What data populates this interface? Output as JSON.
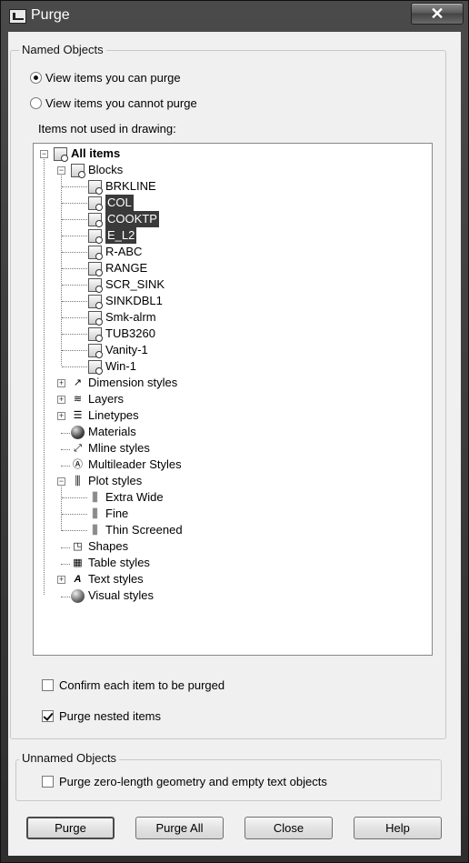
{
  "window": {
    "title": "Purge",
    "close_label": "✕"
  },
  "named_objects": {
    "group_label": "Named Objects",
    "radio_can_purge": "View items you can purge",
    "radio_cannot_purge": "View items you cannot purge",
    "selected_radio": "can_purge",
    "tree_label": "Items not used in drawing:"
  },
  "tree": {
    "root": "All items",
    "blocks_label": "Blocks",
    "blocks": [
      "BRKLINE",
      "COL",
      "COOKTP",
      "E_L2",
      "R-ABC",
      "RANGE",
      "SCR_SINK",
      "SINKDBL1",
      "Smk-alrm",
      "TUB3260",
      "Vanity-1",
      "Win-1"
    ],
    "selected_blocks": [
      "COL",
      "COOKTP",
      "E_L2"
    ],
    "categories": {
      "dimension_styles": "Dimension styles",
      "layers": "Layers",
      "linetypes": "Linetypes",
      "materials": "Materials",
      "mline_styles": "Mline styles",
      "multileader_styles": "Multileader Styles",
      "plot_styles": "Plot styles",
      "shapes": "Shapes",
      "table_styles": "Table styles",
      "text_styles": "Text styles",
      "visual_styles": "Visual styles"
    },
    "plot_styles": [
      "Extra Wide",
      "Fine",
      "Thin Screened"
    ]
  },
  "options": {
    "confirm_each": {
      "label": "Confirm each item to be purged",
      "checked": false
    },
    "purge_nested": {
      "label": "Purge nested items",
      "checked": true
    }
  },
  "unnamed_objects": {
    "group_label": "Unnamed Objects",
    "zero_length": {
      "label": "Purge zero-length geometry and empty text objects",
      "checked": false
    }
  },
  "buttons": {
    "purge": "Purge",
    "purge_all": "Purge All",
    "close": "Close",
    "help": "Help"
  }
}
